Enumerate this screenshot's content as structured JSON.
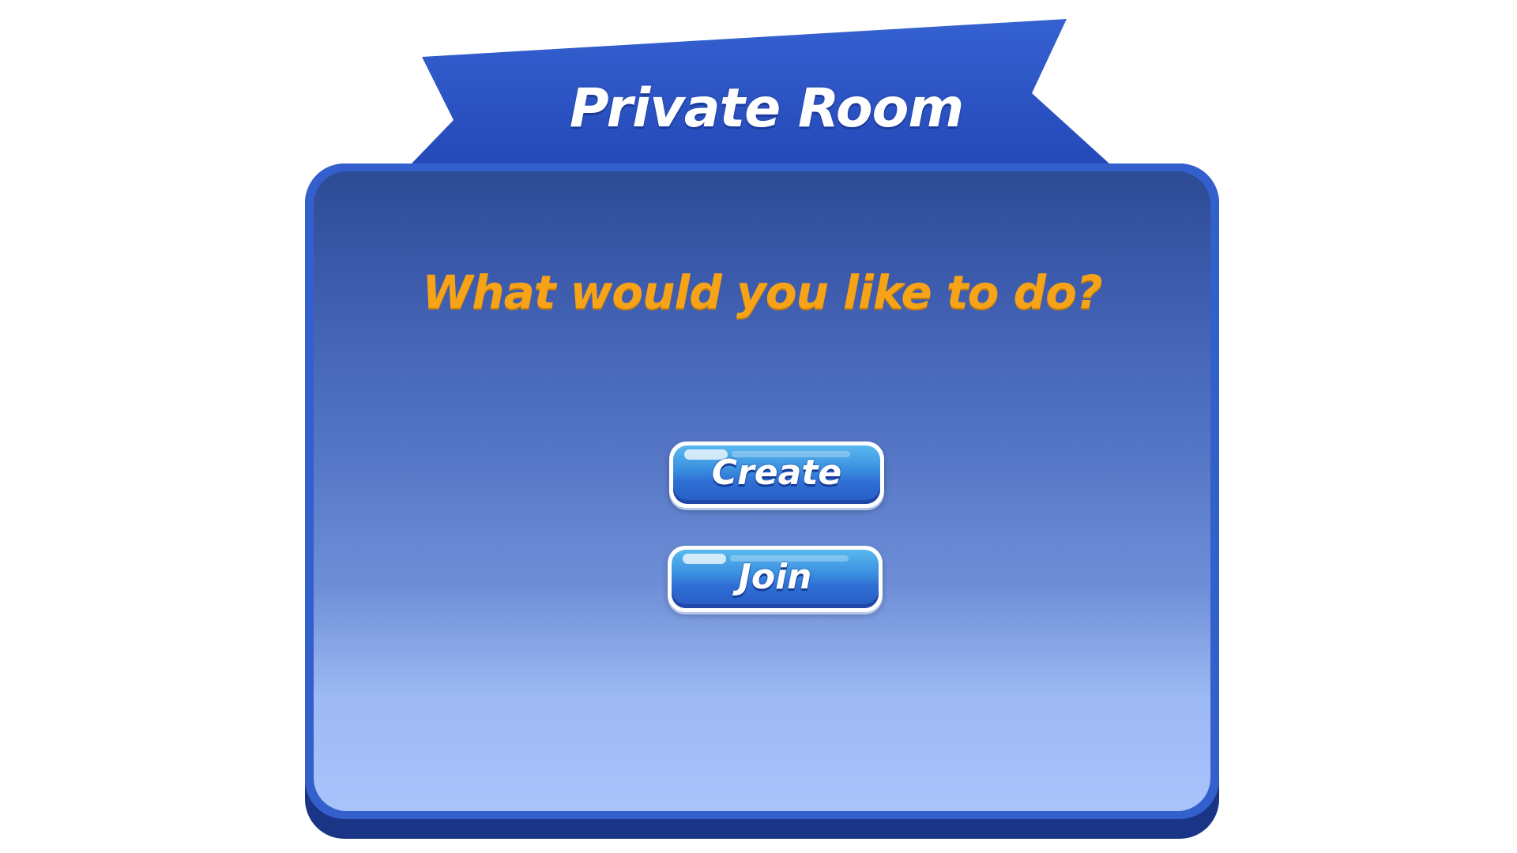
{
  "banner": {
    "title": "Private Room"
  },
  "dialog": {
    "question": "What would you like to do?",
    "buttons": {
      "create_label": "Create",
      "join_label": "Join"
    }
  },
  "colors": {
    "banner": "#2f57c8",
    "panel_frame": "#3360cc",
    "panel_top": "#2c4b95",
    "panel_bottom": "#a9c3fb",
    "question_text": "#f7a318",
    "button": "#2f6fd4"
  }
}
